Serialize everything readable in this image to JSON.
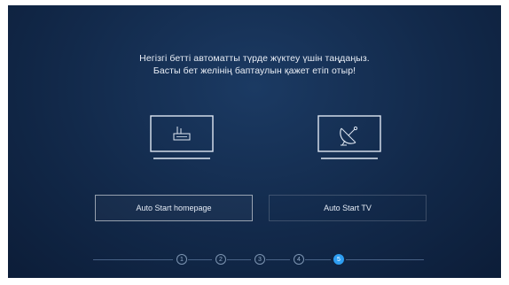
{
  "message": {
    "line1": "Негізгі бетті автоматты түрде жүктеу үшін таңдаңыз.",
    "line2": "Басты бет желінің баптаулын қажет етіп отыр!"
  },
  "options": {
    "homepage": {
      "icon": "router-icon",
      "label": "Auto Start homepage"
    },
    "tv": {
      "icon": "satellite-dish-icon",
      "label": "Auto Start TV"
    }
  },
  "steps": [
    "1",
    "2",
    "3",
    "4",
    "5"
  ],
  "current_step": "5",
  "colors": {
    "accent": "#2e9ef2",
    "background": "#12294a",
    "text": "#e9eef6"
  }
}
